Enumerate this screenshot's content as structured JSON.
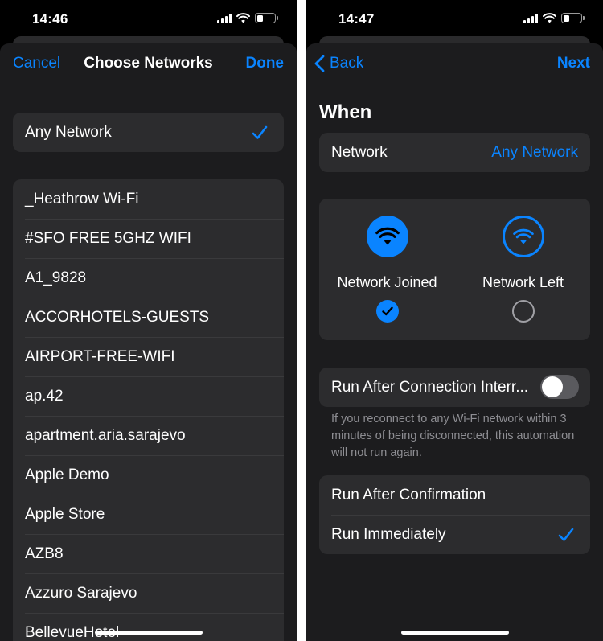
{
  "left": {
    "status": {
      "time": "14:46"
    },
    "nav": {
      "cancel": "Cancel",
      "title": "Choose Networks",
      "done": "Done"
    },
    "any_network": {
      "label": "Any Network",
      "checked": true
    },
    "networks": [
      "_Heathrow Wi-Fi",
      "#SFO FREE 5GHZ WIFI",
      "A1_9828",
      "ACCORHOTELS-GUESTS",
      "AIRPORT-FREE-WIFI",
      "ap.42",
      "apartment.aria.sarajevo",
      "Apple Demo",
      "Apple Store",
      "AZB8",
      "Azzuro Sarajevo",
      "BellevueHotel"
    ]
  },
  "right": {
    "status": {
      "time": "14:47"
    },
    "nav": {
      "back": "Back",
      "next": "Next"
    },
    "section_title": "When",
    "network_row": {
      "label": "Network",
      "value": "Any Network"
    },
    "choices": [
      {
        "label": "Network Joined",
        "selected": true
      },
      {
        "label": "Network Left",
        "selected": false
      }
    ],
    "interruption": {
      "label": "Run After Connection Interr...",
      "enabled": false
    },
    "footnote": "If you reconnect to any Wi-Fi network within 3 minutes of being disconnected, this automation will not run again.",
    "run_options": [
      {
        "label": "Run After Confirmation",
        "checked": false
      },
      {
        "label": "Run Immediately",
        "checked": true
      }
    ]
  },
  "colors": {
    "accent": "#0a84ff",
    "background": "#000000",
    "sheet": "#1c1c1e",
    "card": "#2c2c2e",
    "separator": "#3a3a3c",
    "secondary_text": "#8e8e93"
  },
  "icons": {
    "signal": "cellular-signal-icon",
    "wifi": "wifi-icon",
    "battery": "battery-icon",
    "check": "checkmark-icon",
    "back": "chevron-left-icon"
  }
}
